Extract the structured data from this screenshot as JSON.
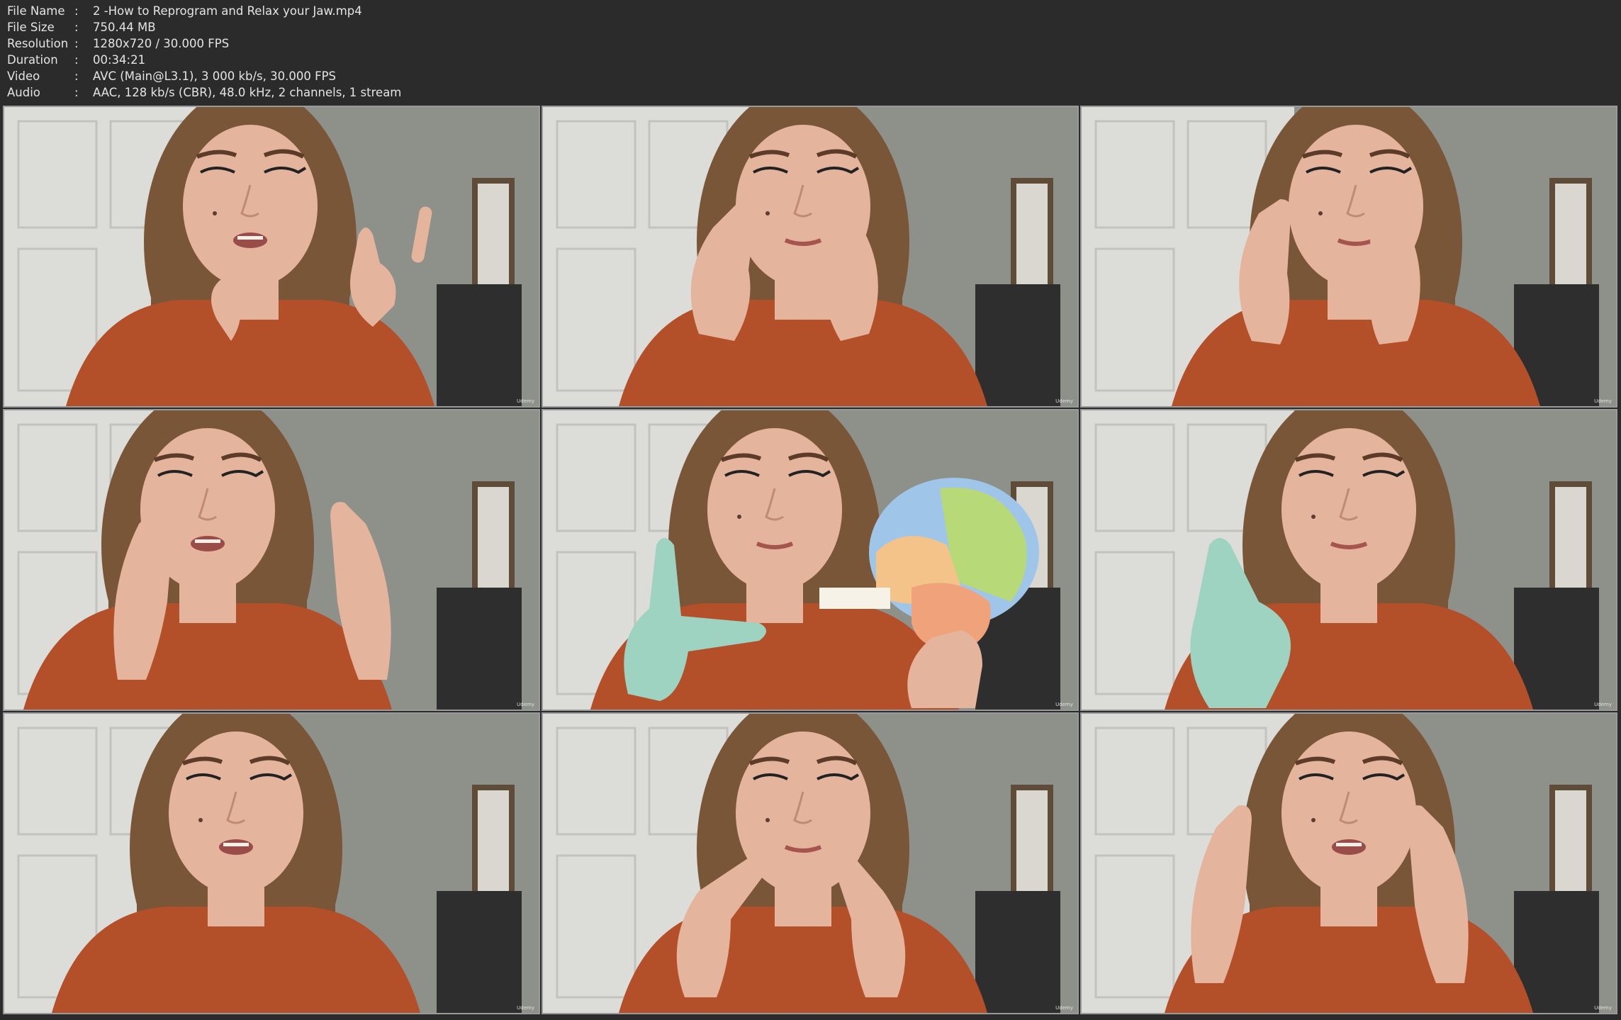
{
  "info": {
    "separator": ":",
    "rows": [
      {
        "label": "File Name",
        "value": "2 -How to Reprogram and Relax your Jaw.mp4"
      },
      {
        "label": "File Size",
        "value": "750.44 MB"
      },
      {
        "label": "Resolution",
        "value": "1280x720 / 30.000 FPS"
      },
      {
        "label": "Duration",
        "value": "00:34:21"
      },
      {
        "label": "Video",
        "value": "AVC (Main@L3.1), 3 000 kb/s, 30.000 FPS"
      },
      {
        "label": "Audio",
        "value": "AAC, 128 kb/s (CBR), 48.0 kHz, 2 channels, 1 stream"
      }
    ]
  },
  "colors": {
    "background": "#2b2b2b",
    "text": "#e4e4e4",
    "frame_border": "#9a9a9a",
    "wall": "#c9c9c4",
    "hair": "#7a5638",
    "skin": "#e4b49d",
    "top": "#b3502a",
    "glove": "#9ed3c2"
  },
  "thumbnails": [
    {
      "scene": "fingers-raised",
      "watermark": "Udemy"
    },
    {
      "scene": "hands-on-cheeks",
      "watermark": "Udemy"
    },
    {
      "scene": "hands-on-jaw",
      "watermark": "Udemy"
    },
    {
      "scene": "hands-on-temples",
      "watermark": "Udemy"
    },
    {
      "scene": "skull-model-glove",
      "watermark": "Udemy"
    },
    {
      "scene": "glove-on-jaw",
      "watermark": "Udemy"
    },
    {
      "scene": "talking",
      "watermark": "Udemy"
    },
    {
      "scene": "fingers-on-nose",
      "watermark": "Udemy"
    },
    {
      "scene": "hands-on-temples-talking",
      "watermark": "Udemy"
    }
  ]
}
